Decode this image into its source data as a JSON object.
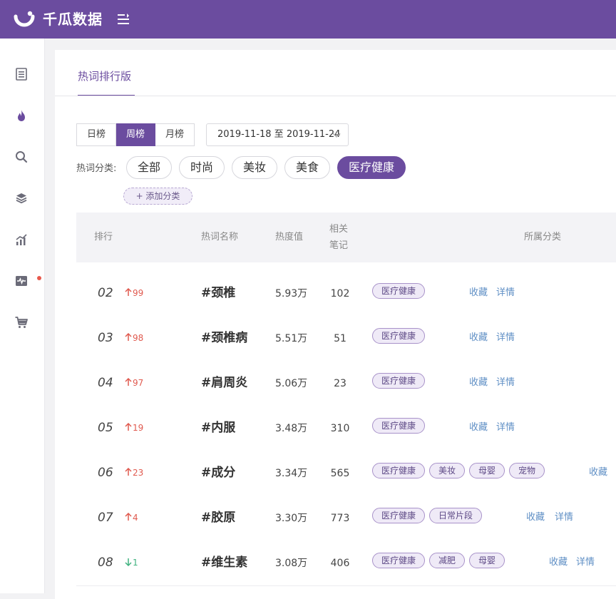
{
  "app": {
    "title": "千瓜数据"
  },
  "tab": {
    "label": "热词排行版"
  },
  "period": {
    "options": [
      "日榜",
      "周榜",
      "月榜"
    ],
    "selected": "周榜"
  },
  "date_range": "2019-11-18 至 2019-11-24",
  "filter": {
    "label": "热词分类:",
    "categories": [
      "全部",
      "时尚",
      "美妆",
      "美食",
      "医疗健康"
    ],
    "selected": "医疗健康",
    "add_label": "+ 添加分类"
  },
  "table": {
    "headers": {
      "rank": "排行",
      "name": "热词名称",
      "heat": "热度值",
      "notes_line1": "相关",
      "notes_line2": "笔记",
      "category": "所属分类"
    },
    "rows": [
      {
        "rank": "02",
        "trend": "up",
        "change": "99",
        "keyword": "#颈椎",
        "heat": "5.93万",
        "notes": "102",
        "tags": [
          "医疗健康"
        ],
        "actions": [
          "收藏",
          "详情"
        ]
      },
      {
        "rank": "03",
        "trend": "up",
        "change": "98",
        "keyword": "#颈椎病",
        "heat": "5.51万",
        "notes": "51",
        "tags": [
          "医疗健康"
        ],
        "actions": [
          "收藏",
          "详情"
        ]
      },
      {
        "rank": "04",
        "trend": "up",
        "change": "97",
        "keyword": "#肩周炎",
        "heat": "5.06万",
        "notes": "23",
        "tags": [
          "医疗健康"
        ],
        "actions": [
          "收藏",
          "详情"
        ]
      },
      {
        "rank": "05",
        "trend": "up",
        "change": "19",
        "keyword": "#内服",
        "heat": "3.48万",
        "notes": "310",
        "tags": [
          "医疗健康"
        ],
        "actions": [
          "收藏",
          "详情"
        ]
      },
      {
        "rank": "06",
        "trend": "up",
        "change": "23",
        "keyword": "#成分",
        "heat": "3.34万",
        "notes": "565",
        "tags": [
          "医疗健康",
          "美妆",
          "母婴",
          "宠物"
        ],
        "actions": [
          "收藏"
        ]
      },
      {
        "rank": "07",
        "trend": "up",
        "change": "4",
        "keyword": "#胶原",
        "heat": "3.30万",
        "notes": "773",
        "tags": [
          "医疗健康",
          "日常片段"
        ],
        "actions": [
          "收藏",
          "详情"
        ]
      },
      {
        "rank": "08",
        "trend": "down",
        "change": "1",
        "keyword": "#维生素",
        "heat": "3.08万",
        "notes": "406",
        "tags": [
          "医疗健康",
          "减肥",
          "母婴"
        ],
        "actions": [
          "收藏",
          "详情"
        ]
      }
    ]
  },
  "colors": {
    "brand": "#6b4c9f",
    "up": "#e05a4f",
    "down": "#3fb27f",
    "link": "#5f8fc5"
  },
  "sidebar_icons": [
    "document-icon",
    "fire-icon",
    "search-icon",
    "box-icon",
    "trend-chart-icon",
    "pulse-monitor-icon",
    "cart-icon"
  ]
}
